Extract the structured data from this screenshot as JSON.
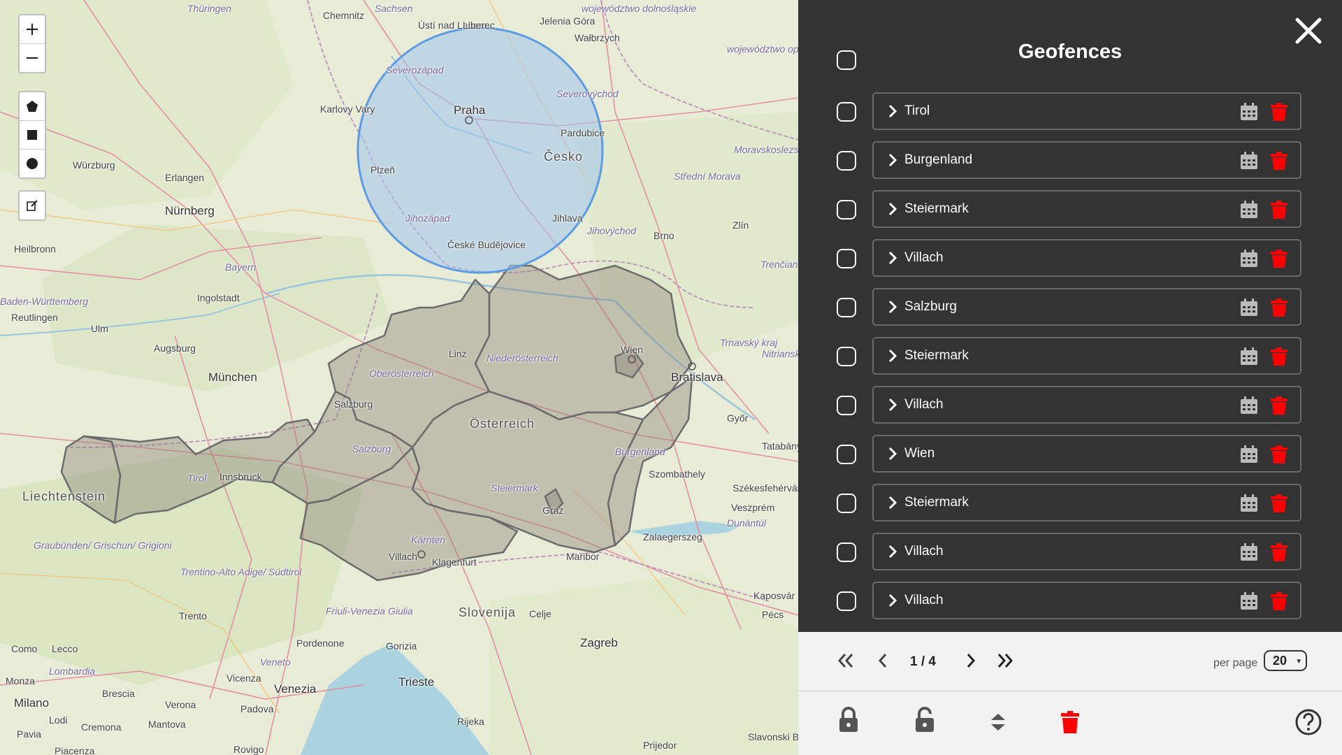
{
  "map": {
    "controls": {
      "zoom_in": "+",
      "zoom_out": "−"
    },
    "places": [
      {
        "name": "Thüringen",
        "cls": "ital"
      },
      {
        "name": "Chemnitz",
        "cls": ""
      },
      {
        "name": "Sachsen",
        "cls": "ital"
      },
      {
        "name": "Ústí nad Labem",
        "cls": ""
      },
      {
        "name": "Liberec",
        "cls": ""
      },
      {
        "name": "Jelenia Góra",
        "cls": ""
      },
      {
        "name": "Wałbrzych",
        "cls": ""
      },
      {
        "name": "województwo dolnośląskie",
        "cls": "ital"
      },
      {
        "name": "województwo opolskie",
        "cls": "ital"
      },
      {
        "name": "Severozápad",
        "cls": "ital"
      },
      {
        "name": "Severovýchod",
        "cls": "ital"
      },
      {
        "name": "Karlovy Vary",
        "cls": ""
      },
      {
        "name": "Praha",
        "cls": "big"
      },
      {
        "name": "Pardubice",
        "cls": ""
      },
      {
        "name": "Česko",
        "cls": "country"
      },
      {
        "name": "Plzeň",
        "cls": ""
      },
      {
        "name": "Würzburg",
        "cls": ""
      },
      {
        "name": "Erlangen",
        "cls": ""
      },
      {
        "name": "Nürnberg",
        "cls": "big"
      },
      {
        "name": "Moravskoslezský",
        "cls": "ital"
      },
      {
        "name": "Střední Morava",
        "cls": "ital"
      },
      {
        "name": "Jihozápad",
        "cls": "ital"
      },
      {
        "name": "Jihlava",
        "cls": ""
      },
      {
        "name": "Jihovýchod",
        "cls": "ital"
      },
      {
        "name": "Brno",
        "cls": ""
      },
      {
        "name": "Zlín",
        "cls": ""
      },
      {
        "name": "České Budějovice",
        "cls": ""
      },
      {
        "name": "Heilbronn",
        "cls": ""
      },
      {
        "name": "Bayern",
        "cls": "ital"
      },
      {
        "name": "Trenčiansky kraj",
        "cls": "ital"
      },
      {
        "name": "Ingolstadt",
        "cls": ""
      },
      {
        "name": "Baden-Württemberg",
        "cls": "ital"
      },
      {
        "name": "Reutlingen",
        "cls": ""
      },
      {
        "name": "Ulm",
        "cls": ""
      },
      {
        "name": "Augsburg",
        "cls": ""
      },
      {
        "name": "Linz",
        "cls": ""
      },
      {
        "name": "Niederösterreich",
        "cls": "ital"
      },
      {
        "name": "Wien",
        "cls": ""
      },
      {
        "name": "Trnavský kraj",
        "cls": "ital"
      },
      {
        "name": "Nitriansky kraj",
        "cls": "ital"
      },
      {
        "name": "Bratislava",
        "cls": "big"
      },
      {
        "name": "München",
        "cls": "big"
      },
      {
        "name": "Oberösterreich",
        "cls": "ital"
      },
      {
        "name": "Salzburg",
        "cls": ""
      },
      {
        "name": "Österreich",
        "cls": "country"
      },
      {
        "name": "Győr",
        "cls": ""
      },
      {
        "name": "Tatabánya",
        "cls": ""
      },
      {
        "name": "Salzburg",
        "cls": "ital"
      },
      {
        "name": "Burgenland",
        "cls": "ital"
      },
      {
        "name": "Szombathely",
        "cls": ""
      },
      {
        "name": "Liechtenstein",
        "cls": "country"
      },
      {
        "name": "Tirol",
        "cls": "ital"
      },
      {
        "name": "Innsbruck",
        "cls": ""
      },
      {
        "name": "Steiermark",
        "cls": "ital"
      },
      {
        "name": "Székesfehérvár",
        "cls": ""
      },
      {
        "name": "Veszprém",
        "cls": ""
      },
      {
        "name": "Graz",
        "cls": ""
      },
      {
        "name": "Dunántúl",
        "cls": "ital"
      },
      {
        "name": "Graubünden/ Grischun/ Grigioni",
        "cls": "ital"
      },
      {
        "name": "Kärnten",
        "cls": "ital"
      },
      {
        "name": "Zalaegerszeg",
        "cls": ""
      },
      {
        "name": "Villach",
        "cls": ""
      },
      {
        "name": "Klagenfurt",
        "cls": ""
      },
      {
        "name": "Maribor",
        "cls": ""
      },
      {
        "name": "Trentino-Alto Adige/ Südtirol",
        "cls": "ital"
      },
      {
        "name": "Kaposvár",
        "cls": ""
      },
      {
        "name": "Slovenija",
        "cls": "country"
      },
      {
        "name": "Celje",
        "cls": ""
      },
      {
        "name": "Trento",
        "cls": ""
      },
      {
        "name": "Friuli-Venezia Giulia",
        "cls": "ital"
      },
      {
        "name": "Pécs",
        "cls": ""
      },
      {
        "name": "Como",
        "cls": ""
      },
      {
        "name": "Lecco",
        "cls": ""
      },
      {
        "name": "Pordenone",
        "cls": ""
      },
      {
        "name": "Gorizia",
        "cls": ""
      },
      {
        "name": "Zagreb",
        "cls": "big"
      },
      {
        "name": "Lombardia",
        "cls": "ital"
      },
      {
        "name": "Veneto",
        "cls": "ital"
      },
      {
        "name": "Vicenza",
        "cls": ""
      },
      {
        "name": "Trieste",
        "cls": "big"
      },
      {
        "name": "Monza",
        "cls": ""
      },
      {
        "name": "Brescia",
        "cls": ""
      },
      {
        "name": "Venezia",
        "cls": "big"
      },
      {
        "name": "Verona",
        "cls": ""
      },
      {
        "name": "Padova",
        "cls": ""
      },
      {
        "name": "Milano",
        "cls": "big"
      },
      {
        "name": "Lodi",
        "cls": ""
      },
      {
        "name": "Cremona",
        "cls": ""
      },
      {
        "name": "Mantova",
        "cls": ""
      },
      {
        "name": "Rijeka",
        "cls": ""
      },
      {
        "name": "Pavia",
        "cls": ""
      },
      {
        "name": "Piacenza",
        "cls": ""
      },
      {
        "name": "Rovigo",
        "cls": ""
      },
      {
        "name": "Prijedor",
        "cls": ""
      },
      {
        "name": "Slavonski Brod",
        "cls": ""
      }
    ]
  },
  "panel": {
    "title": "Geofences",
    "rows": [
      {
        "label": "Tirol"
      },
      {
        "label": "Burgenland"
      },
      {
        "label": "Steiermark"
      },
      {
        "label": "Villach"
      },
      {
        "label": "Salzburg"
      },
      {
        "label": "Steiermark"
      },
      {
        "label": "Villach"
      },
      {
        "label": "Wien"
      },
      {
        "label": "Steiermark"
      },
      {
        "label": "Villach"
      },
      {
        "label": "Villach"
      }
    ],
    "pagination": {
      "page_indicator": "1 / 4",
      "per_page_label": "per page",
      "per_page_value": "20",
      "per_page_arrow": "▾"
    },
    "colors": {
      "panel_bg": "#333333",
      "delete_red": "#ff0000",
      "footer_bg": "#f2f2f2",
      "circle_fill": "#9ec5ef",
      "circle_stroke": "#5b9be3",
      "region_fill": "#8a8478"
    },
    "icons": [
      "close-icon",
      "chevron-right-icon",
      "calendar-icon",
      "trash-icon",
      "first-page-icon",
      "prev-page-icon",
      "next-page-icon",
      "last-page-icon",
      "lock-icon",
      "unlock-icon",
      "sort-icon",
      "help-icon"
    ]
  }
}
